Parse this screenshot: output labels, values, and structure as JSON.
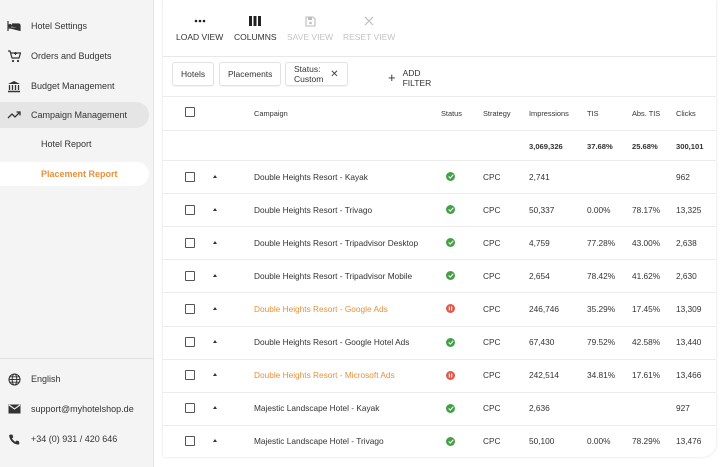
{
  "colors": {
    "accent": "#e8913a",
    "active_green": "#43a047",
    "paused_red": "#e2574c"
  },
  "sidebar": {
    "items": [
      {
        "label": "Hotel Settings",
        "icon": "bed-icon"
      },
      {
        "label": "Orders and Budgets",
        "icon": "cart-icon"
      },
      {
        "label": "Budget Management",
        "icon": "bank-icon"
      },
      {
        "label": "Campaign Management",
        "icon": "trending-up-icon"
      }
    ],
    "sub_items": [
      {
        "label": "Hotel Report"
      },
      {
        "label": "Placement Report"
      }
    ],
    "footer": [
      {
        "label": "English",
        "icon": "globe-icon"
      },
      {
        "label": "support@myhotelshop.de",
        "icon": "mail-icon"
      },
      {
        "label": "+34 (0) 931 / 420 646",
        "icon": "phone-icon"
      }
    ]
  },
  "toolbar": {
    "load_view": "LOAD VIEW",
    "columns": "COLUMNS",
    "save_view": "SAVE VIEW",
    "reset_view": "RESET VIEW"
  },
  "filters": {
    "chips": [
      "Hotels",
      "Placements",
      "Status: Custom"
    ],
    "add_filter": "ADD FILTER"
  },
  "table": {
    "headers": {
      "campaign": "Campaign",
      "status": "Status",
      "strategy": "Strategy",
      "impressions": "Impressions",
      "tis": "TIS",
      "abs_tis": "Abs. TIS",
      "clicks": "Clicks"
    },
    "totals": {
      "impressions": "3,069,326",
      "tis": "37.68%",
      "abs_tis": "25.68%",
      "clicks": "300,101"
    },
    "rows": [
      {
        "campaign": "Double Heights Resort - Kayak",
        "status": "active",
        "strategy": "CPC",
        "impressions": "2,741",
        "tis": "",
        "abs_tis": "",
        "clicks": "962"
      },
      {
        "campaign": "Double Heights Resort - Trivago",
        "status": "active",
        "strategy": "CPC",
        "impressions": "50,337",
        "tis": "0.00%",
        "abs_tis": "78.17%",
        "clicks": "13,325"
      },
      {
        "campaign": "Double Heights Resort - Tripadvisor Desktop",
        "status": "active",
        "strategy": "CPC",
        "impressions": "4,759",
        "tis": "77.28%",
        "abs_tis": "43.00%",
        "clicks": "2,638"
      },
      {
        "campaign": "Double Heights Resort - Tripadvisor Mobile",
        "status": "active",
        "strategy": "CPC",
        "impressions": "2,654",
        "tis": "78.42%",
        "abs_tis": "41.62%",
        "clicks": "2,630"
      },
      {
        "campaign": "Double Heights Resort - Google Ads",
        "status": "paused",
        "strategy": "CPC",
        "impressions": "246,746",
        "tis": "35.29%",
        "abs_tis": "17.45%",
        "clicks": "13,309"
      },
      {
        "campaign": "Double Heights Resort - Google Hotel Ads",
        "status": "active",
        "strategy": "CPC",
        "impressions": "67,430",
        "tis": "79.52%",
        "abs_tis": "42.58%",
        "clicks": "13,440"
      },
      {
        "campaign": "Double Heights Resort - Microsoft Ads",
        "status": "paused",
        "strategy": "CPC",
        "impressions": "242,514",
        "tis": "34.81%",
        "abs_tis": "17.61%",
        "clicks": "13,466"
      },
      {
        "campaign": "Majestic Landscape Hotel - Kayak",
        "status": "active",
        "strategy": "CPC",
        "impressions": "2,636",
        "tis": "",
        "abs_tis": "",
        "clicks": "927"
      },
      {
        "campaign": "Majestic Landscape Hotel - Trivago",
        "status": "active",
        "strategy": "CPC",
        "impressions": "50,100",
        "tis": "0.00%",
        "abs_tis": "78.29%",
        "clicks": "13,476"
      }
    ]
  }
}
